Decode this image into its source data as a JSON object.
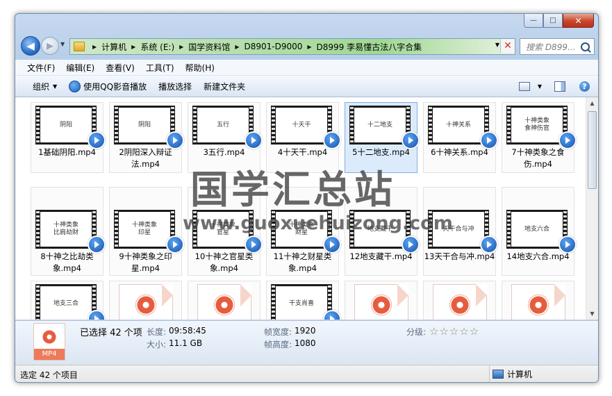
{
  "window": {
    "controls": {
      "minimize": "—",
      "maximize": "□",
      "close": "✕"
    }
  },
  "nav": {
    "back": "◀",
    "forward": "▶",
    "history_arrow": "▼",
    "address_dropdown": "▼",
    "address_clear": "✕",
    "breadcrumbs": [
      "计算机",
      "系统 (E:)",
      "国学资料馆",
      "D8901-D9000",
      "D8999 李易懂古法八字合集"
    ],
    "search_placeholder": "搜索 D899..."
  },
  "menu": [
    "文件(F)",
    "编辑(E)",
    "查看(V)",
    "工具(T)",
    "帮助(H)"
  ],
  "toolbar": {
    "organize": "组织",
    "dd_arrow": "▼",
    "play_qq": "使用QQ影音播放",
    "play_select": "播放选择",
    "new_folder": "新建文件夹",
    "view_arrow": "▼",
    "help": "?"
  },
  "files": [
    {
      "name": "1基础阴阳.mp4",
      "thumb_text": "阴阳",
      "type": "video"
    },
    {
      "name": "2阴阳深入辩证法.mp4",
      "thumb_text": "阴阳",
      "type": "video"
    },
    {
      "name": "3五行.mp4",
      "thumb_text": "五行",
      "type": "video"
    },
    {
      "name": "4十天干.mp4",
      "thumb_text": "十天干",
      "type": "video"
    },
    {
      "name": "5十二地支.mp4",
      "thumb_text": "十二地支",
      "type": "video",
      "selected": true
    },
    {
      "name": "6十神关系.mp4",
      "thumb_text": "十神关系",
      "type": "video"
    },
    {
      "name": "7十神类象之食伤.mp4",
      "thumb_text": "十神类象\n食神伤官",
      "type": "video"
    },
    {
      "name": "8十神之比劫类象.mp4",
      "thumb_text": "十神类象\n比肩劫财",
      "type": "video"
    },
    {
      "name": "9十神类象之印星.mp4",
      "thumb_text": "十神类象\n印星",
      "type": "video"
    },
    {
      "name": "10十神之官星类象.mp4",
      "thumb_text": "十神类象\n官星",
      "type": "video"
    },
    {
      "name": "11十神之财星类象.mp4",
      "thumb_text": "十神类象\n财星",
      "type": "video"
    },
    {
      "name": "12地支藏干.mp4",
      "thumb_text": "地支藏干",
      "type": "video"
    },
    {
      "name": "13天干合与冲.mp4",
      "thumb_text": "天干合与冲",
      "type": "video"
    },
    {
      "name": "14地支六合.mp4",
      "thumb_text": "地支六合",
      "type": "video"
    },
    {
      "name": "",
      "thumb_text": "地支三合",
      "type": "video"
    },
    {
      "name": "",
      "thumb_text": "",
      "type": "file"
    },
    {
      "name": "",
      "thumb_text": "",
      "type": "file"
    },
    {
      "name": "",
      "thumb_text": "干支肖喜",
      "type": "video"
    },
    {
      "name": "",
      "thumb_text": "",
      "type": "file"
    },
    {
      "name": "",
      "thumb_text": "",
      "type": "file"
    },
    {
      "name": "",
      "thumb_text": "",
      "type": "file"
    }
  ],
  "watermark": {
    "title": "国学汇总站",
    "url": "www.guoxuehuizong.com"
  },
  "scrollbar": {
    "up": "▲",
    "down": "▼"
  },
  "details": {
    "selected": "已选择 42 个项",
    "length_label": "长度:",
    "length_value": "09:58:45",
    "size_label": "大小:",
    "size_value": "11.1 GB",
    "frame_width_label": "帧宽度:",
    "frame_width_value": "1920",
    "frame_height_label": "帧高度:",
    "frame_height_value": "1080",
    "rating_label": "分级:",
    "stars": "☆☆☆☆☆",
    "icon_label": "MP4"
  },
  "status": {
    "left": "选定 42 个项目",
    "right": "计算机"
  }
}
